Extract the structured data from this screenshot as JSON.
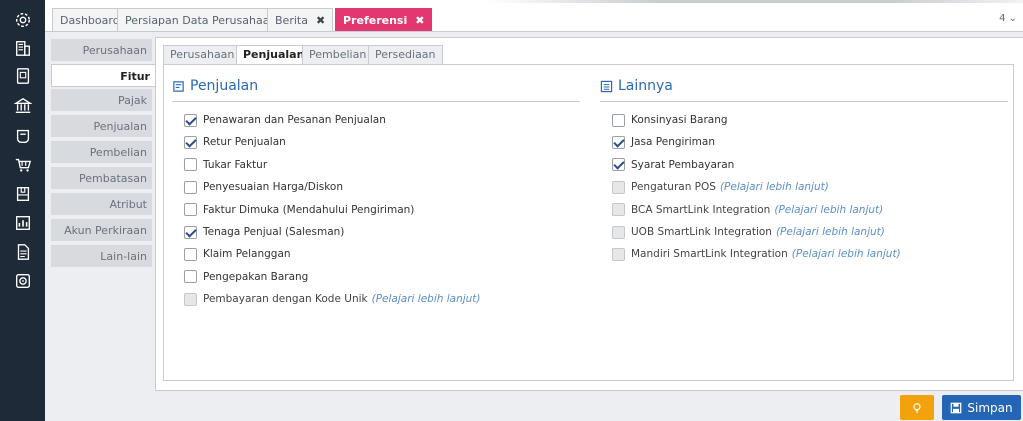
{
  "rail_icons": [
    "gear-icon",
    "building-icon",
    "document-icon",
    "bank-icon",
    "cart-icon",
    "basket-icon",
    "box-icon",
    "report-icon",
    "file-icon",
    "target-icon"
  ],
  "tabs": [
    {
      "label": "Dashboard"
    },
    {
      "label": "Persiapan Data Perusahaan"
    },
    {
      "label": "Berita",
      "close": "✖"
    },
    {
      "label": "Preferensi",
      "close": "✖"
    }
  ],
  "tab_count": "4 ⌄",
  "menu": [
    "Perusahaan",
    "Fitur",
    "Pajak",
    "Penjualan",
    "Pembelian",
    "Pembatasan",
    "Atribut Tambahan",
    "Akun Perkiraan",
    "Lain-lain"
  ],
  "subtabs": [
    "Perusahaan",
    "Penjualan",
    "Pembelian",
    "Persediaan"
  ],
  "left_section": {
    "title": "Penjualan",
    "options": [
      {
        "label": "Penawaran dan Pesanan Penjualan",
        "checked": true
      },
      {
        "label": "Retur Penjualan",
        "checked": true
      },
      {
        "label": "Tukar Faktur",
        "checked": false
      },
      {
        "label": "Penyesuaian Harga/Diskon",
        "checked": false
      },
      {
        "label": "Faktur Dimuka (Mendahului Pengiriman)",
        "checked": false
      },
      {
        "label": "Tenaga Penjual (Salesman)",
        "checked": true
      },
      {
        "label": "Klaim Pelanggan",
        "checked": false
      },
      {
        "label": "Pengepakan Barang",
        "checked": false
      },
      {
        "label": "Pembayaran dengan Kode Unik",
        "checked": false,
        "disabled": true,
        "link": "(Pelajari lebih lanjut)"
      }
    ]
  },
  "right_section": {
    "title": "Lainnya",
    "options": [
      {
        "label": "Konsinyasi Barang",
        "checked": false
      },
      {
        "label": "Jasa Pengiriman",
        "checked": true
      },
      {
        "label": "Syarat Pembayaran",
        "checked": true
      },
      {
        "label": "Pengaturan POS",
        "checked": false,
        "disabled": true,
        "link": "(Pelajari lebih lanjut)"
      },
      {
        "label": "BCA SmartLink Integration",
        "checked": false,
        "disabled": true,
        "link": "(Pelajari lebih lanjut)"
      },
      {
        "label": "UOB SmartLink Integration",
        "checked": false,
        "disabled": true,
        "link": "(Pelajari lebih lanjut)"
      },
      {
        "label": "Mandiri SmartLink Integration",
        "checked": false,
        "disabled": true,
        "link": "(Pelajari lebih lanjut)"
      }
    ]
  },
  "buttons": {
    "save_label": "Simpan"
  },
  "colors": {
    "rail": "#1e2a38",
    "active_tab": "#e2386f",
    "title": "#2a6ab3",
    "save": "#2565b5",
    "bulb": "#f4a20c"
  }
}
